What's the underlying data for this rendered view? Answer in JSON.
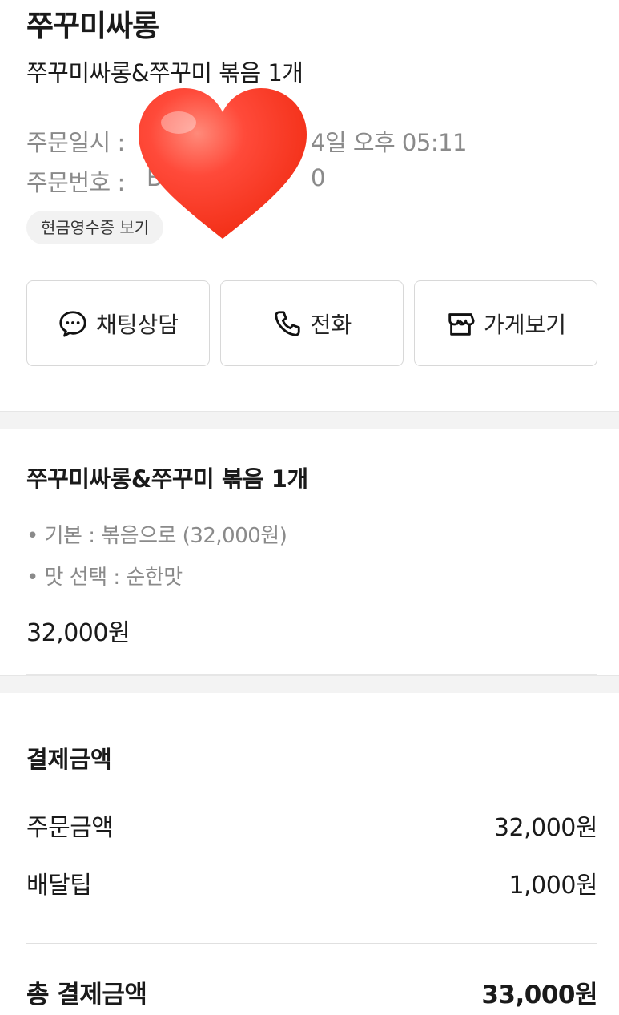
{
  "store": {
    "name": "쭈꾸미싸롱"
  },
  "order": {
    "summary": "쭈꾸미싸롱&쭈꾸미 볶음 1개",
    "date_label": "주문일시 :",
    "date_value_visible": "4일 오후 05:11",
    "number_label": "주문번호 :",
    "number_value_visible": "B",
    "number_value_tail": "0",
    "receipt_button": "현금영수증 보기"
  },
  "actions": [
    {
      "label": "채팅상담",
      "icon": "chat-icon"
    },
    {
      "label": "전화",
      "icon": "phone-icon"
    },
    {
      "label": "가게보기",
      "icon": "store-icon"
    }
  ],
  "item": {
    "name": "쭈꾸미싸롱&쭈꾸미 볶음 1개",
    "options": [
      "• 기본 : 볶음으로 (32,000원)",
      "• 맛 선택 : 순한맛"
    ],
    "price": "32,000원"
  },
  "payment": {
    "title": "결제금액",
    "rows": [
      {
        "label": "주문금액",
        "value": "32,000원"
      },
      {
        "label": "배달팁",
        "value": "1,000원"
      }
    ],
    "total_label": "총 결제금액",
    "total_value": "33,000원"
  },
  "colors": {
    "heart": "#ff3b2f",
    "muted_text": "#8a8a8a",
    "chip_bg": "#f2f2f2"
  }
}
